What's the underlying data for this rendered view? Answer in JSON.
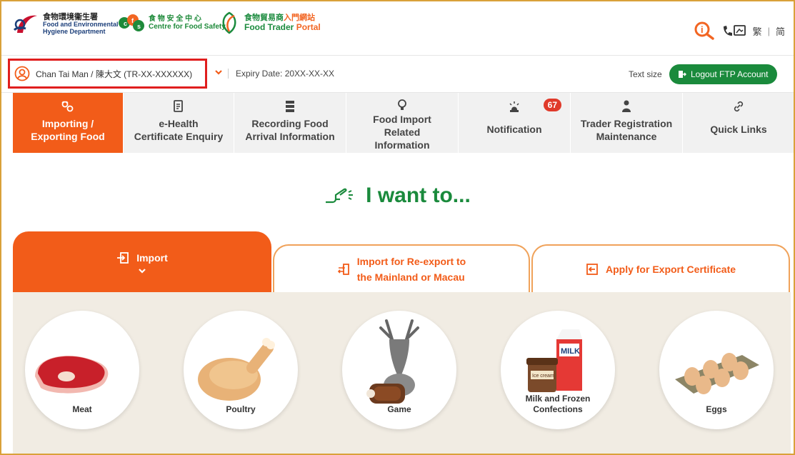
{
  "header": {
    "fehd_zh": "食物環境衞生署",
    "fehd_en_1": "Food and Environmental",
    "fehd_en_2": "Hygiene Department",
    "cfs_zh": "食 物 安 全 中 心",
    "cfs_en": "Centre for Food Safety",
    "ftp_zh_1": "食物貿易商",
    "ftp_zh_2": "入門網站",
    "ftp_en_1": "Food Trader",
    "ftp_en_2": "Portal",
    "lang_trad": "繁",
    "lang_sep": "|",
    "lang_simp": "简"
  },
  "user_bar": {
    "user_name": "Chan Tai Man / 陳大文 (TR-XX-XXXXXX)",
    "expiry": "Expiry Date: 20XX-XX-XX",
    "text_size": "Text size",
    "logout": "Logout FTP Account"
  },
  "nav": {
    "items": [
      {
        "label_1": "Importing /",
        "label_2": "Exporting Food"
      },
      {
        "label_1": "e-Health",
        "label_2": "Certificate Enquiry"
      },
      {
        "label_1": "Recording Food",
        "label_2": "Arrival Information"
      },
      {
        "label_1": "Food Import",
        "label_2": "Related",
        "label_3": "Information"
      },
      {
        "label_1": "Notification",
        "badge": "67"
      },
      {
        "label_1": "Trader Registration",
        "label_2": "Maintenance"
      },
      {
        "label_1": "Quick Links"
      }
    ]
  },
  "want_title": "I want to...",
  "tabs": {
    "import": "Import",
    "reexport_1": "Import for Re-export to",
    "reexport_2": "the Mainland or Macau",
    "export_cert": "Apply for Export Certificate"
  },
  "categories": {
    "meat": "Meat",
    "poultry": "Poultry",
    "game": "Game",
    "milk_1": "Milk and Frozen",
    "milk_2": "Confections",
    "eggs": "Eggs",
    "ice_cream_text": "Ice cream",
    "milk_carton_text": "MILK"
  },
  "colors": {
    "accent_orange": "#f25c19",
    "brand_green": "#1a8a3c",
    "highlight_red": "#e01e1e",
    "panel_beige": "#f1ece3"
  }
}
